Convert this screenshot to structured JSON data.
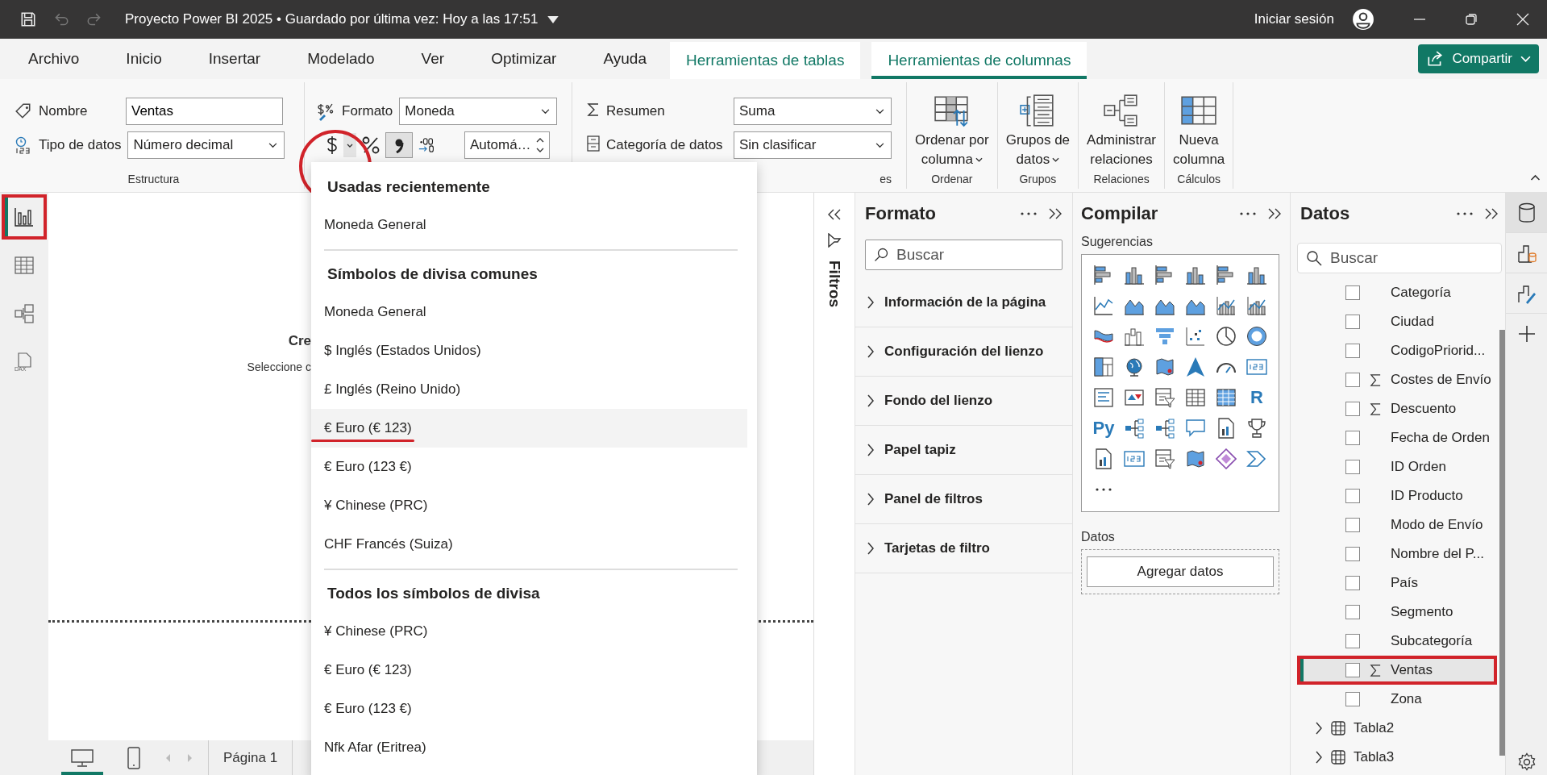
{
  "title_bar": {
    "title": "Proyecto Power BI 2025 • Guardado por última vez: Hoy a las 17:51",
    "undo_disabled": true,
    "redo_disabled": true,
    "sign_in": "Iniciar sesión"
  },
  "menu_tabs": [
    {
      "label": "Archivo",
      "selected": false,
      "contextual": false
    },
    {
      "label": "Inicio",
      "selected": false,
      "contextual": false
    },
    {
      "label": "Insertar",
      "selected": false,
      "contextual": false
    },
    {
      "label": "Modelado",
      "selected": false,
      "contextual": false
    },
    {
      "label": "Ver",
      "selected": false,
      "contextual": false
    },
    {
      "label": "Optimizar",
      "selected": false,
      "contextual": false
    },
    {
      "label": "Ayuda",
      "selected": false,
      "contextual": false
    },
    {
      "label": "Herramientas de tablas",
      "selected": false,
      "contextual": true
    },
    {
      "label": "Herramientas de columnas",
      "selected": true,
      "contextual": true
    }
  ],
  "share_button": "Compartir",
  "ribbon": {
    "structure": {
      "name_label": "Nombre",
      "name_value": "Ventas",
      "type_label": "Tipo de datos",
      "type_value": "Número decimal",
      "group_label": "Estructura"
    },
    "format": {
      "format_label": "Formato",
      "format_value": "Moneda",
      "currency_marked": true,
      "comma_pressed": true,
      "decimals_value": "Automá…"
    },
    "properties": {
      "summary_label": "Resumen",
      "summary_value": "Suma",
      "category_label": "Categoría de datos",
      "category_value": "Sin clasificar",
      "group_label": "es"
    },
    "groups": [
      {
        "kind": "sort",
        "lines": [
          "Ordenar por",
          "columna"
        ],
        "has_menu": true,
        "group_label": "Ordenar"
      },
      {
        "kind": "groups",
        "lines": [
          "Grupos de",
          "datos"
        ],
        "has_menu": true,
        "group_label": "Grupos"
      },
      {
        "kind": "relations",
        "lines": [
          "Administrar",
          "relaciones"
        ],
        "has_menu": false,
        "group_label": "Relaciones"
      },
      {
        "kind": "newcolumn",
        "lines": [
          "Nueva",
          "columna"
        ],
        "has_menu": false,
        "group_label": "Cálculos"
      }
    ]
  },
  "left_nav": [
    {
      "kind": "report",
      "selected": true,
      "marked": true
    },
    {
      "kind": "table",
      "selected": false
    },
    {
      "kind": "model",
      "selected": false
    },
    {
      "kind": "dax",
      "label": "DAX",
      "selected": false
    }
  ],
  "canvas": {
    "heading": "Cre",
    "subtext": "Seleccione c",
    "pages": [
      {
        "label": "Página 1",
        "selected": true
      }
    ],
    "views": [
      {
        "kind": "desktop",
        "selected": true
      },
      {
        "kind": "phone",
        "selected": false
      }
    ]
  },
  "currency_menu": {
    "sections": [
      {
        "heading": "Usadas recientemente",
        "items": [
          {
            "label": "Moneda General",
            "hovered": false,
            "marked": false
          }
        ]
      },
      {
        "heading": "Símbolos de divisa comunes",
        "items": [
          {
            "label": "Moneda General",
            "hovered": false,
            "marked": false
          },
          {
            "label": "$ Inglés (Estados Unidos)",
            "hovered": false,
            "marked": false
          },
          {
            "label": "£ Inglés (Reino Unido)",
            "hovered": false,
            "marked": false
          },
          {
            "label": "€ Euro (€ 123)",
            "hovered": true,
            "marked": true
          },
          {
            "label": "€ Euro (123 €)",
            "hovered": false,
            "marked": false
          },
          {
            "label": "¥ Chinese (PRC)",
            "hovered": false,
            "marked": false
          },
          {
            "label": "CHF Francés (Suiza)",
            "hovered": false,
            "marked": false
          }
        ]
      },
      {
        "heading": "Todos los símbolos de divisa",
        "items": [
          {
            "label": "¥ Chinese (PRC)",
            "hovered": false,
            "marked": false
          },
          {
            "label": "€ Euro (€ 123)",
            "hovered": false,
            "marked": false
          },
          {
            "label": "€ Euro (123 €)",
            "hovered": false,
            "marked": false
          },
          {
            "label": "Nfk Afar (Eritrea)",
            "hovered": false,
            "marked": false
          }
        ]
      }
    ]
  },
  "filters_pane": {
    "label": "Filtros"
  },
  "format_pane": {
    "title": "Formato",
    "search_placeholder": "Buscar",
    "sections": [
      {
        "label": "Información de la página",
        "expanded": false
      },
      {
        "label": "Configuración del lienzo",
        "expanded": false
      },
      {
        "label": "Fondo del lienzo",
        "expanded": false
      },
      {
        "label": "Papel tapiz",
        "expanded": false
      },
      {
        "label": "Panel de filtros",
        "expanded": false
      },
      {
        "label": "Tarjetas de filtro",
        "expanded": false
      }
    ]
  },
  "build_pane": {
    "title": "Compilar",
    "suggestions_label": "Sugerencias",
    "visuals": [
      {
        "kind": "hbar"
      },
      {
        "kind": "vbar"
      },
      {
        "kind": "hbar"
      },
      {
        "kind": "vbar"
      },
      {
        "kind": "hbar"
      },
      {
        "kind": "vbar"
      },
      {
        "kind": "line"
      },
      {
        "kind": "area"
      },
      {
        "kind": "area"
      },
      {
        "kind": "area"
      },
      {
        "kind": "combo"
      },
      {
        "kind": "combo"
      },
      {
        "kind": "ribbon"
      },
      {
        "kind": "waterfall"
      },
      {
        "kind": "funnel"
      },
      {
        "kind": "scatter"
      },
      {
        "kind": "pie"
      },
      {
        "kind": "donut"
      },
      {
        "kind": "treemap"
      },
      {
        "kind": "globe"
      },
      {
        "kind": "map"
      },
      {
        "kind": "arrow"
      },
      {
        "kind": "gauge"
      },
      {
        "kind": "card"
      },
      {
        "kind": "multicard"
      },
      {
        "kind": "kpi"
      },
      {
        "kind": "slicer"
      },
      {
        "kind": "table"
      },
      {
        "kind": "matrix"
      },
      {
        "kind": "letter",
        "label": "R"
      },
      {
        "kind": "letter",
        "label": "Py"
      },
      {
        "kind": "tree"
      },
      {
        "kind": "tree"
      },
      {
        "kind": "bubble"
      },
      {
        "kind": "document"
      },
      {
        "kind": "trophy"
      },
      {
        "kind": "document"
      },
      {
        "kind": "card"
      },
      {
        "kind": "slicer"
      },
      {
        "kind": "map"
      },
      {
        "kind": "diamond"
      },
      {
        "kind": "chevron"
      }
    ],
    "data_label": "Datos",
    "add_button": "Agregar datos"
  },
  "data_pane": {
    "title": "Datos",
    "search_placeholder": "Buscar",
    "fields": [
      {
        "label": "Categoría",
        "checked": false,
        "measure": false,
        "selected": false,
        "marked": false
      },
      {
        "label": "Ciudad",
        "checked": false,
        "measure": false,
        "selected": false,
        "marked": false
      },
      {
        "label": "CodigoPriorid...",
        "checked": false,
        "measure": false,
        "selected": false,
        "marked": false
      },
      {
        "label": "Costes de Envío",
        "checked": false,
        "measure": true,
        "selected": false,
        "marked": false
      },
      {
        "label": "Descuento",
        "checked": false,
        "measure": true,
        "selected": false,
        "marked": false
      },
      {
        "label": "Fecha de Orden",
        "checked": false,
        "measure": false,
        "selected": false,
        "marked": false
      },
      {
        "label": "ID Orden",
        "checked": false,
        "measure": false,
        "selected": false,
        "marked": false
      },
      {
        "label": "ID Producto",
        "checked": false,
        "measure": false,
        "selected": false,
        "marked": false
      },
      {
        "label": "Modo de Envío",
        "checked": false,
        "measure": false,
        "selected": false,
        "marked": false
      },
      {
        "label": "Nombre del P...",
        "checked": false,
        "measure": false,
        "selected": false,
        "marked": false
      },
      {
        "label": "País",
        "checked": false,
        "measure": false,
        "selected": false,
        "marked": false
      },
      {
        "label": "Segmento",
        "checked": false,
        "measure": false,
        "selected": false,
        "marked": false
      },
      {
        "label": "Subcategoría",
        "checked": false,
        "measure": false,
        "selected": false,
        "marked": false
      },
      {
        "label": "Ventas",
        "checked": false,
        "measure": true,
        "selected": true,
        "marked": true
      },
      {
        "label": "Zona",
        "checked": false,
        "measure": false,
        "selected": false,
        "marked": false
      }
    ],
    "tables": [
      {
        "label": "Tabla2",
        "expanded": false
      },
      {
        "label": "Tabla3",
        "expanded": false
      }
    ]
  },
  "side_strip": [
    {
      "kind": "data",
      "selected": true
    },
    {
      "kind": "build",
      "selected": false
    },
    {
      "kind": "format",
      "selected": false
    }
  ]
}
